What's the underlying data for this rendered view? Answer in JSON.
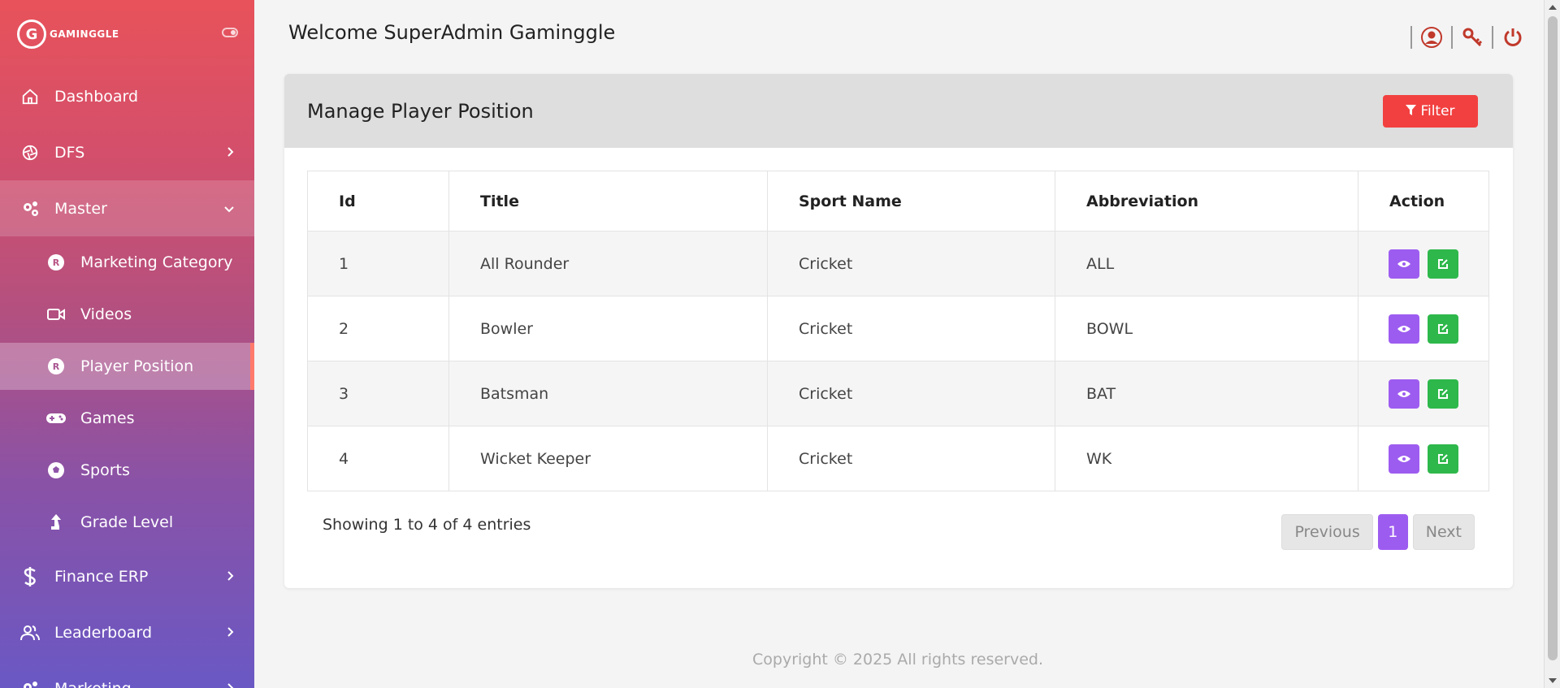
{
  "brand": {
    "logo_letter": "G",
    "name": "GAMINGGLE"
  },
  "sidebar": {
    "items": [
      {
        "label": "Dashboard",
        "icon": "home-icon"
      },
      {
        "label": "DFS",
        "icon": "aperture-icon"
      },
      {
        "label": "Master",
        "icon": "gears-icon"
      },
      {
        "label": "Finance ERP",
        "icon": "dollar-icon"
      },
      {
        "label": "Leaderboard",
        "icon": "users-icon"
      },
      {
        "label": "Marketing",
        "icon": "gears-icon"
      }
    ],
    "sub_items": [
      {
        "label": "Marketing Category",
        "icon": "badge-icon"
      },
      {
        "label": "Videos",
        "icon": "video-icon"
      },
      {
        "label": "Player Position",
        "icon": "badge-icon"
      },
      {
        "label": "Games",
        "icon": "gamepad-icon"
      },
      {
        "label": "Sports",
        "icon": "soccer-ball-icon"
      },
      {
        "label": "Grade Level",
        "icon": "arrow-up-icon"
      }
    ]
  },
  "header": {
    "welcome": "Welcome SuperAdmin Gaminggle"
  },
  "card": {
    "title": "Manage Player Position",
    "filter_label": "Filter"
  },
  "table": {
    "columns": [
      "Id",
      "Title",
      "Sport Name",
      "Abbreviation",
      "Action"
    ],
    "rows": [
      [
        "1",
        "All Rounder",
        "Cricket",
        "ALL"
      ],
      [
        "2",
        "Bowler",
        "Cricket",
        "BOWL"
      ],
      [
        "3",
        "Batsman",
        "Cricket",
        "BAT"
      ],
      [
        "4",
        "Wicket Keeper",
        "Cricket",
        "WK"
      ]
    ]
  },
  "pagination": {
    "showing": "Showing 1 to 4 of 4 entries",
    "previous": "Previous",
    "current": "1",
    "next": "Next"
  },
  "footer": {
    "copyright": "Copyright © 2025  All rights reserved."
  },
  "colors": {
    "accent": "#9d5cf0",
    "filter": "#f24040",
    "edit": "#2eb84b",
    "topicon": "#c0392b"
  }
}
